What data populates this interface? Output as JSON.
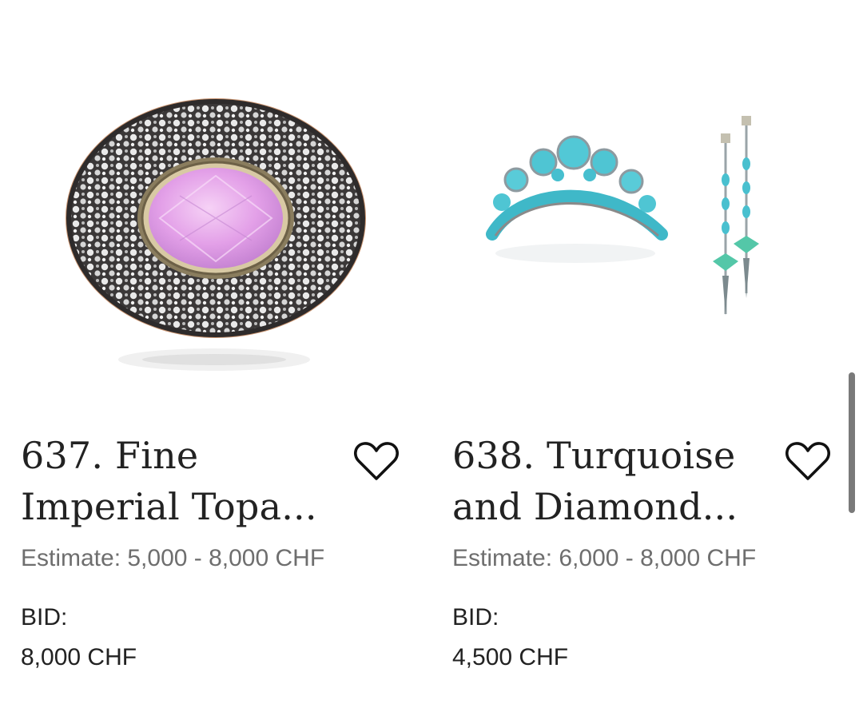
{
  "lots": [
    {
      "title_line1": "637. Fine",
      "title_line2": "Imperial Topa...",
      "estimate": "Estimate: 5,000 - 8,000 CHF",
      "bid_label": "BID:",
      "bid_value": "8,000 CHF",
      "image": "pink-topaz-diamond-brooch",
      "favorite_icon": "heart-outline-icon"
    },
    {
      "title_line1": "638. Turquoise",
      "title_line2": "and Diamond...",
      "estimate": "Estimate: 6,000 - 8,000 CHF",
      "bid_label": "BID:",
      "bid_value": "4,500 CHF",
      "image": "turquoise-tiara-and-earrings",
      "favorite_icon": "heart-outline-icon"
    }
  ],
  "colors": {
    "text": "#222222",
    "muted": "#6e6e6e",
    "topaz": "#e6a2ea",
    "turquoise": "#4fc9d8"
  }
}
